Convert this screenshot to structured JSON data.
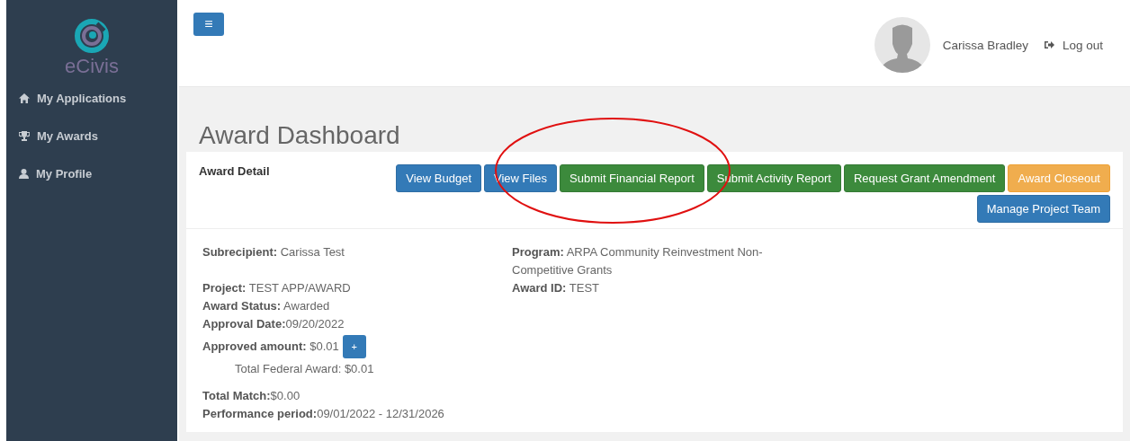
{
  "sidebar": {
    "logo": "eCivis",
    "items": [
      {
        "kind": "home",
        "label": "My Applications"
      },
      {
        "kind": "trophy",
        "label": "My Awards"
      },
      {
        "kind": "user",
        "label": "My Profile"
      }
    ]
  },
  "header": {
    "menu_button": "≡",
    "user_name": "Carissa Bradley",
    "logout": "Log out"
  },
  "page_title": "Award Dashboard",
  "panel": {
    "title": "Award Detail",
    "buttons": [
      {
        "label": "View Budget",
        "kind": "primary"
      },
      {
        "label": "View Files",
        "kind": "primary"
      },
      {
        "label": "Submit Financial Report",
        "kind": "success"
      },
      {
        "label": "Submit Activity Report",
        "kind": "success"
      },
      {
        "label": "Request Grant Amendment",
        "kind": "success"
      },
      {
        "label": "Award Closeout",
        "kind": "warning"
      },
      {
        "label": "Manage Project Team",
        "kind": "primary"
      }
    ],
    "left_fields": [
      {
        "text": "**Subrecipient:** Carissa Test",
        "kind": "gap"
      },
      {
        "text": "**Project:** TEST APP/AWARD",
        "kind": "line"
      },
      {
        "text": "**Award Status:** Awarded",
        "kind": "line"
      },
      {
        "text": "**Approval Date:**09/20/2022",
        "kind": "line"
      },
      {
        "text": "**Approved amount:** $0.01",
        "kind": "expand",
        "button": "+"
      },
      {
        "text": "Total Federal Award: $0.01",
        "kind": "indent"
      },
      {
        "text": "**Total Match:**$0.00",
        "kind": "line"
      },
      {
        "text": "**Performance period:**09/01/2022 - 12/31/2026",
        "kind": "line"
      }
    ],
    "right_fields": [
      {
        "text": "**Program:** ARPA Community Reinvestment Non-Competitive Grants"
      },
      {
        "text": "**Award ID:** TEST"
      }
    ]
  }
}
